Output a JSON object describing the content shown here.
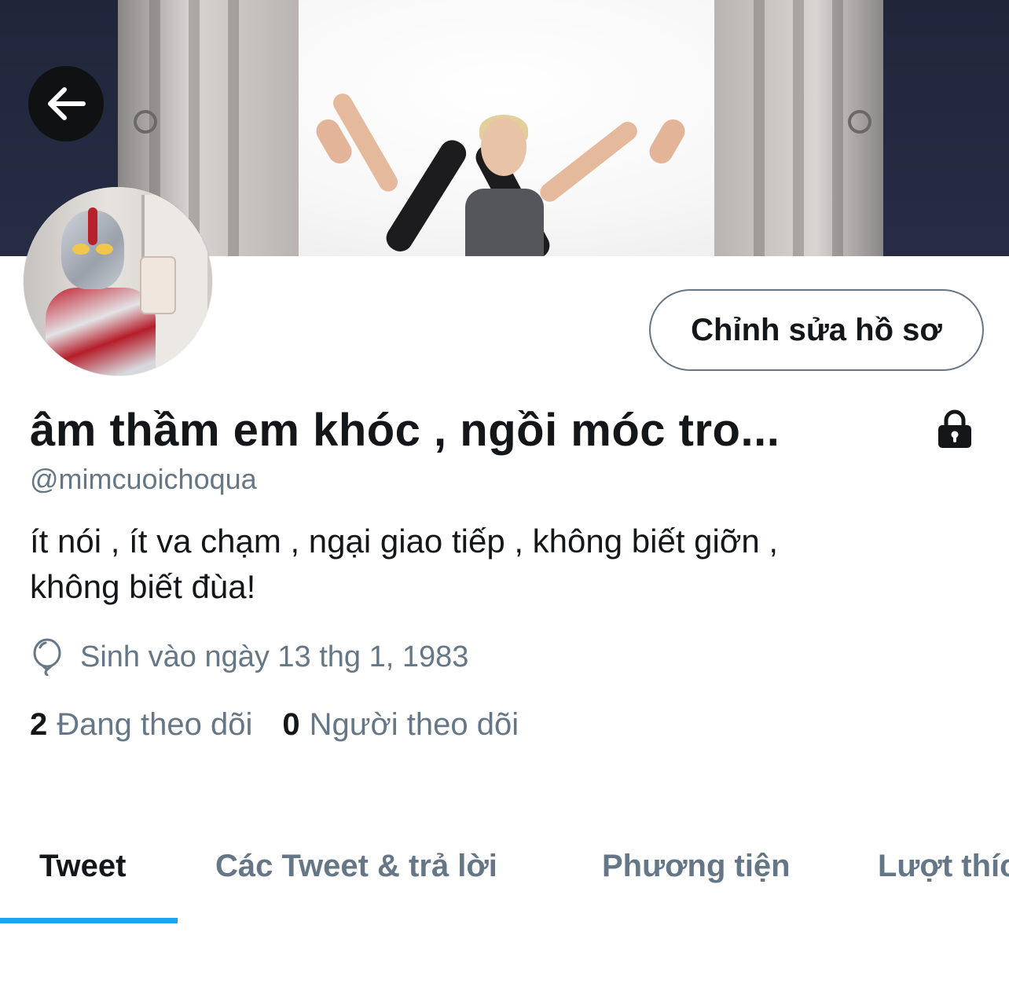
{
  "profile": {
    "display_name": "âm thầm em khóc , ngồi móc tro...",
    "handle": "@mimcuoichoqua",
    "bio_lines": [
      "ít nói , ít va chạm , ngại giao tiếp , không biết giỡn ,",
      "không biết đùa!"
    ],
    "birthday": "Sinh vào ngày 13 thg 1, 1983",
    "protected_icon": "lock-icon",
    "birthday_icon": "balloon-icon"
  },
  "actions": {
    "edit_profile_label": "Chỉnh sửa hồ sơ",
    "back_icon": "arrow-left-icon"
  },
  "stats": {
    "following": {
      "count": "2",
      "label": "Đang theo dõi"
    },
    "followers": {
      "count": "0",
      "label": "Người theo dõi"
    }
  },
  "tabs": [
    {
      "label": "Tweet",
      "active": true
    },
    {
      "label": "Các Tweet & trả lời",
      "active": false
    },
    {
      "label": "Phương tiện",
      "active": false
    },
    {
      "label": "Lượt thích",
      "active": false
    }
  ],
  "colors": {
    "accent": "#1da1f2",
    "text_primary": "#14171a",
    "text_secondary": "#657786"
  }
}
